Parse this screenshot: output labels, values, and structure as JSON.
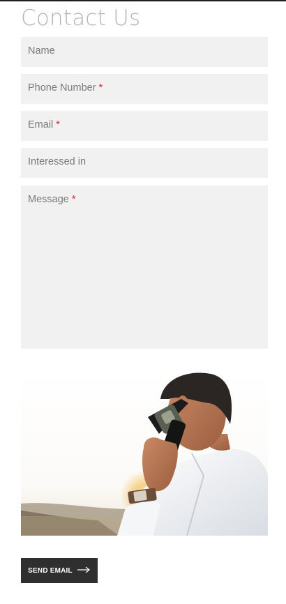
{
  "form": {
    "title": "Contact Us",
    "required_marker": "*",
    "fields": {
      "name": {
        "label": "Name"
      },
      "phone": {
        "label": "Phone Number"
      },
      "email": {
        "label": "Email"
      },
      "interested": {
        "label": "Interessed in"
      },
      "message": {
        "label": "Message"
      }
    },
    "submit_label": "SEND EMAIL",
    "submit_icon": "arrow-right-icon"
  },
  "colors": {
    "field_bg": "#f1f1f1",
    "required": "#d0292b",
    "button_bg": "#2f2f2f",
    "title": "#b5b5b5"
  },
  "media": {
    "photo_icon": "man-on-phone-photo"
  }
}
